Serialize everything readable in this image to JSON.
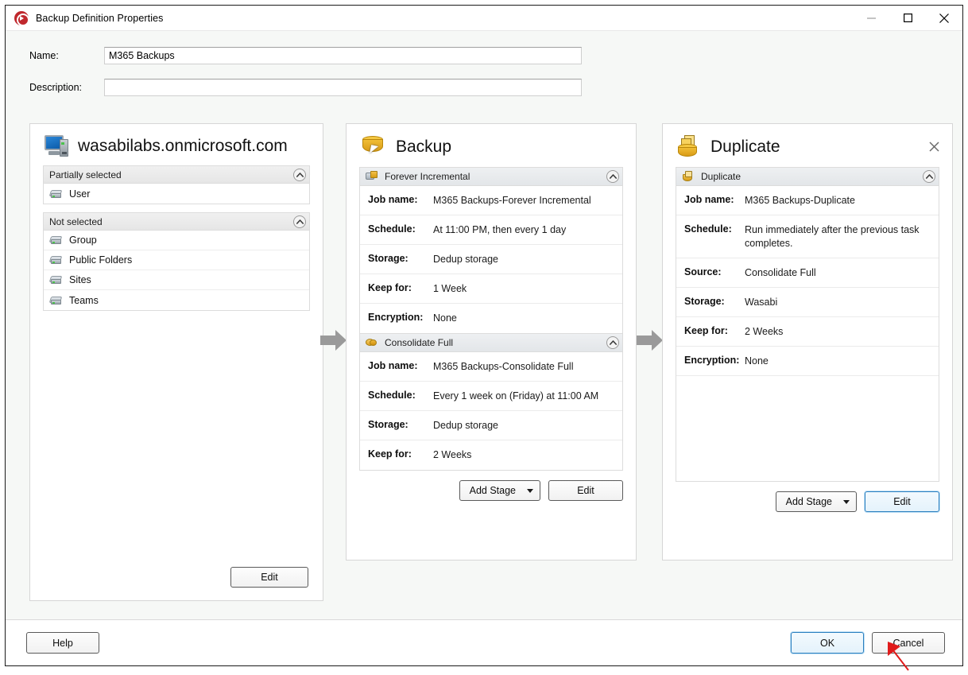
{
  "window": {
    "title": "Backup Definition Properties",
    "app_icon": "disc-record-icon",
    "controls": {
      "minimize": "minimize-icon",
      "maximize": "maximize-icon",
      "close": "close-icon"
    }
  },
  "form": {
    "name_label": "Name:",
    "name_value": "M365 Backups",
    "name_placeholder": "",
    "description_label": "Description:",
    "description_value": "",
    "description_placeholder": ""
  },
  "source_panel": {
    "icon": "computer-monitor-icon",
    "title": "wasabilabs.onmicrosoft.com",
    "groups": [
      {
        "header": "Partially selected",
        "collapse_icon": "chevron-up-icon",
        "items": [
          {
            "icon": "disk-icon",
            "label": "User"
          }
        ]
      },
      {
        "header": "Not selected",
        "collapse_icon": "chevron-up-icon",
        "items": [
          {
            "icon": "disk-icon",
            "label": "Group"
          },
          {
            "icon": "disk-icon",
            "label": "Public Folders"
          },
          {
            "icon": "disk-icon",
            "label": "Sites"
          },
          {
            "icon": "disk-icon",
            "label": "Teams"
          }
        ]
      }
    ],
    "edit_button": "Edit"
  },
  "backup_panel": {
    "icon": "backup-drum-icon",
    "title": "Backup",
    "stages": [
      {
        "name": "Forever Incremental",
        "icon": "forever-incremental-icon",
        "collapse_icon": "chevron-up-icon",
        "rows": [
          {
            "key": "Job name:",
            "value": "M365 Backups-Forever Incremental"
          },
          {
            "key": "Schedule:",
            "value": "At 11:00 PM, then every 1 day"
          },
          {
            "key": "Storage:",
            "value": "Dedup storage"
          },
          {
            "key": "Keep for:",
            "value": "1 Week"
          },
          {
            "key": "Encryption:",
            "value": "None"
          }
        ]
      },
      {
        "name": "Consolidate Full",
        "icon": "consolidate-full-icon",
        "collapse_icon": "chevron-up-icon",
        "rows": [
          {
            "key": "Job name:",
            "value": "M365 Backups-Consolidate Full"
          },
          {
            "key": "Schedule:",
            "value": "Every 1 week on (Friday) at 11:00 AM"
          },
          {
            "key": "Storage:",
            "value": "Dedup storage"
          },
          {
            "key": "Keep for:",
            "value": "2 Weeks"
          }
        ]
      }
    ],
    "add_stage_button": "Add Stage",
    "add_stage_caret": "caret-down-icon",
    "edit_button": "Edit"
  },
  "duplicate_panel": {
    "icon": "duplicate-icon",
    "title": "Duplicate",
    "close_icon": "close-icon",
    "stages": [
      {
        "name": "Duplicate",
        "icon": "duplicate-lock-icon",
        "collapse_icon": "chevron-up-icon",
        "rows": [
          {
            "key": "Job name:",
            "value": "M365 Backups-Duplicate"
          },
          {
            "key": "Schedule:",
            "value": "Run immediately after the previous task completes."
          },
          {
            "key": "Source:",
            "value": "Consolidate Full"
          },
          {
            "key": "Storage:",
            "value": "Wasabi"
          },
          {
            "key": "Keep for:",
            "value": "2 Weeks"
          },
          {
            "key": "Encryption:",
            "value": "None"
          }
        ]
      }
    ],
    "add_stage_button": "Add Stage",
    "add_stage_caret": "caret-down-icon",
    "edit_button": "Edit"
  },
  "flow": {
    "arrow_1": "flow-arrow-icon",
    "arrow_2": "flow-arrow-icon"
  },
  "footer": {
    "help_button": "Help",
    "ok_button": "OK",
    "cancel_button": "Cancel"
  },
  "annotation": {
    "arrow": "red-pointer-arrow",
    "color": "#e01b1b",
    "target": "ok-button"
  },
  "colors": {
    "accent_focus": "#2b7fbf",
    "window_bg": "#f6f8f6",
    "panel_bg": "#ffffff",
    "group_header": "#e9ebed",
    "annotation_red": "#e01b1b"
  }
}
